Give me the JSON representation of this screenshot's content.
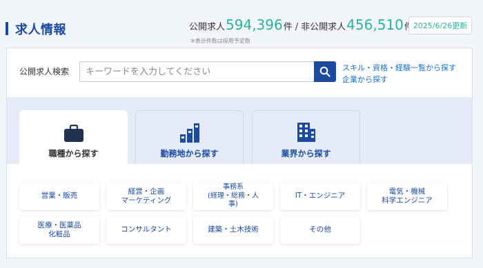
{
  "header": {
    "title": "求人情報",
    "public_label": "公開求人",
    "public_count": "594,396",
    "public_unit": "件",
    "separator": "/",
    "private_label": "非公開求人",
    "private_count": "456,510",
    "private_unit": "件",
    "updated": "2025/6/26更新",
    "note": "※表示件数は採用予定数"
  },
  "search": {
    "label": "公開求人検索",
    "placeholder": "キーワードを入力してください",
    "value": "",
    "icon": "search-icon",
    "link_skills": "スキル・資格・経験一覧から探す",
    "link_companies": "企業から探す"
  },
  "tabs": [
    {
      "label": "職種から探す",
      "icon": "briefcase-icon",
      "active": true
    },
    {
      "label": "勤務地から探す",
      "icon": "location-bars-icon",
      "active": false
    },
    {
      "label": "業界から探す",
      "icon": "building-icon",
      "active": false
    }
  ],
  "categories": [
    "営業・販売",
    "経営・企画\nマーケティング",
    "事務系\n(経理・総務・人\n事)",
    "IT・エンジニア",
    "電気・機械\n科学エンジニア",
    "医療・医薬品\n化粧品",
    "コンサルタント",
    "建築・土木技術",
    "その他"
  ],
  "colors": {
    "accent": "#1a4ba0",
    "count_green": "#2bb39a",
    "link": "#1a6fd0",
    "tab_bg": "#e4ebf7"
  }
}
